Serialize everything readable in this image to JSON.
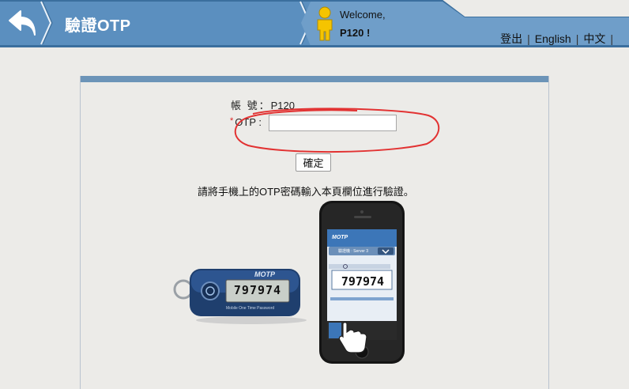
{
  "header": {
    "title": "驗證OTP",
    "welcome": "Welcome,",
    "username": "P120 !",
    "links": [
      "登出",
      "English",
      "中文"
    ]
  },
  "form": {
    "account_label": "帳 號：",
    "account_value": "P120",
    "otp_label": "OTP :",
    "otp_required_mark": "*",
    "otp_value": "",
    "confirm_label": "確定",
    "instruction": "請將手機上的OTP密碼輸入本頁欄位進行驗證。"
  },
  "illustration": {
    "token_brand": "MOTP",
    "token_code": "797974",
    "token_caption": "Mobile One Time Password",
    "phone_brand": "MOTP",
    "phone_server": "驗證機 : Server 3",
    "phone_code": "797974"
  },
  "colors": {
    "header_blue": "#5b8fbf",
    "panel_bar": "#6c94b8",
    "highlight_red": "#e23232"
  },
  "icons": {
    "back": "back-arrow-icon",
    "user": "user-figure-icon"
  }
}
